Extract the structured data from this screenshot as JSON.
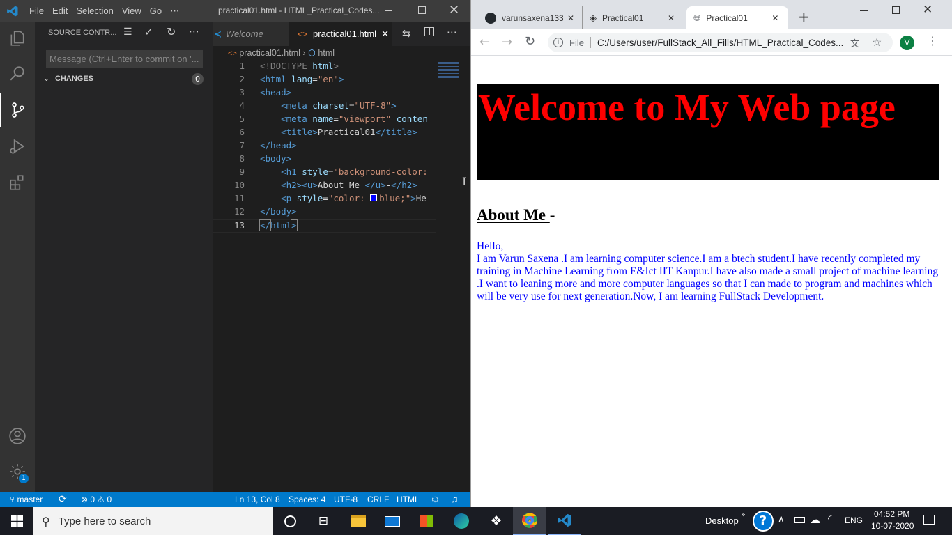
{
  "vscode": {
    "menu": [
      "File",
      "Edit",
      "Selection",
      "View",
      "Go",
      "⋯"
    ],
    "title": "practical01.html - HTML_Practical_Codes...",
    "sidebar": {
      "title": "SOURCE CONTR...",
      "message_placeholder": "Message (Ctrl+Enter to commit on '...",
      "changes_label": "CHANGES",
      "changes_count": "0"
    },
    "tabs": [
      {
        "label": "Welcome"
      },
      {
        "label": "practical01.html"
      }
    ],
    "breadcrumb": {
      "file": "practical01.html",
      "node": "html"
    },
    "line_numbers": [
      "1",
      "2",
      "3",
      "4",
      "5",
      "6",
      "7",
      "8",
      "9",
      "10",
      "11",
      "12",
      "13"
    ],
    "code": {
      "l1_doctype": "<!DOCTYPE",
      "l1_html": " html",
      "l1_close": ">",
      "l2_open": "<html",
      "l2_attr": " lang",
      "l2_eq": "=",
      "l2_val": "\"en\"",
      "l2_close": ">",
      "l3": "<head>",
      "l4_open": "    <meta",
      "l4_attr": " charset",
      "l4_eq": "=",
      "l4_val": "\"UTF-8\"",
      "l4_close": ">",
      "l5_open": "    <meta",
      "l5_attr": " name",
      "l5_eq": "=",
      "l5_val": "\"viewport\"",
      "l5_attr2": " conten",
      "l6_open": "    <title>",
      "l6_text": "Practical01",
      "l6_close": "</title>",
      "l7": "</head>",
      "l8": "<body>",
      "l9_open": "    <h1",
      "l9_attr": " style",
      "l9_eq": "=",
      "l9_val": "\"background-color:",
      "l10_open": "    <h2><u>",
      "l10_text": "About Me ",
      "l10_u": "</u>",
      "l10_dash": "-",
      "l10_close": "</h2>",
      "l11_open": "    <p",
      "l11_attr": " style",
      "l11_eq": "=",
      "l11_val1": "\"color: ",
      "l11_val2": "blue;\"",
      "l11_close": ">",
      "l11_text": "He",
      "l12": "</body>",
      "l13_open": "</",
      "l13_name": "html",
      "l13_close": ">"
    },
    "status": {
      "branch": "master",
      "problems": "⊗ 0 ⚠ 0",
      "position": "Ln 13, Col 8",
      "spaces": "Spaces: 4",
      "encoding": "UTF-8",
      "eol": "CRLF",
      "language": "HTML"
    },
    "settings_badge": "1",
    "accent_color": "#007acc"
  },
  "browser": {
    "tabs": [
      {
        "label": "varunsaxena133"
      },
      {
        "label": "Practical01"
      },
      {
        "label": "Practical01"
      }
    ],
    "url_label": "File",
    "url": "C:/Users/user/FullStack_All_Fills/HTML_Practical_Codes...",
    "profile_initial": "V",
    "page": {
      "h1": "Welcome to My Web page",
      "h2_underlined": "About Me ",
      "h2_suffix": "-",
      "greeting": "Hello,",
      "paragraph": "I am Varun Saxena .I am learning computer science.I am a btech student.I have recently completed my training in Machine Learning from E&Ict IIT Kanpur.I have also made a small project of machine learning .I want to leaning more and more computer languages so that I can made to program and machines which will be very use for next generation.Now, I am learning FullStack Development."
    }
  },
  "taskbar": {
    "search_placeholder": "Type here to search",
    "desktop_label": "Desktop",
    "language": "ENG",
    "time": "04:52 PM",
    "date": "10-07-2020"
  }
}
